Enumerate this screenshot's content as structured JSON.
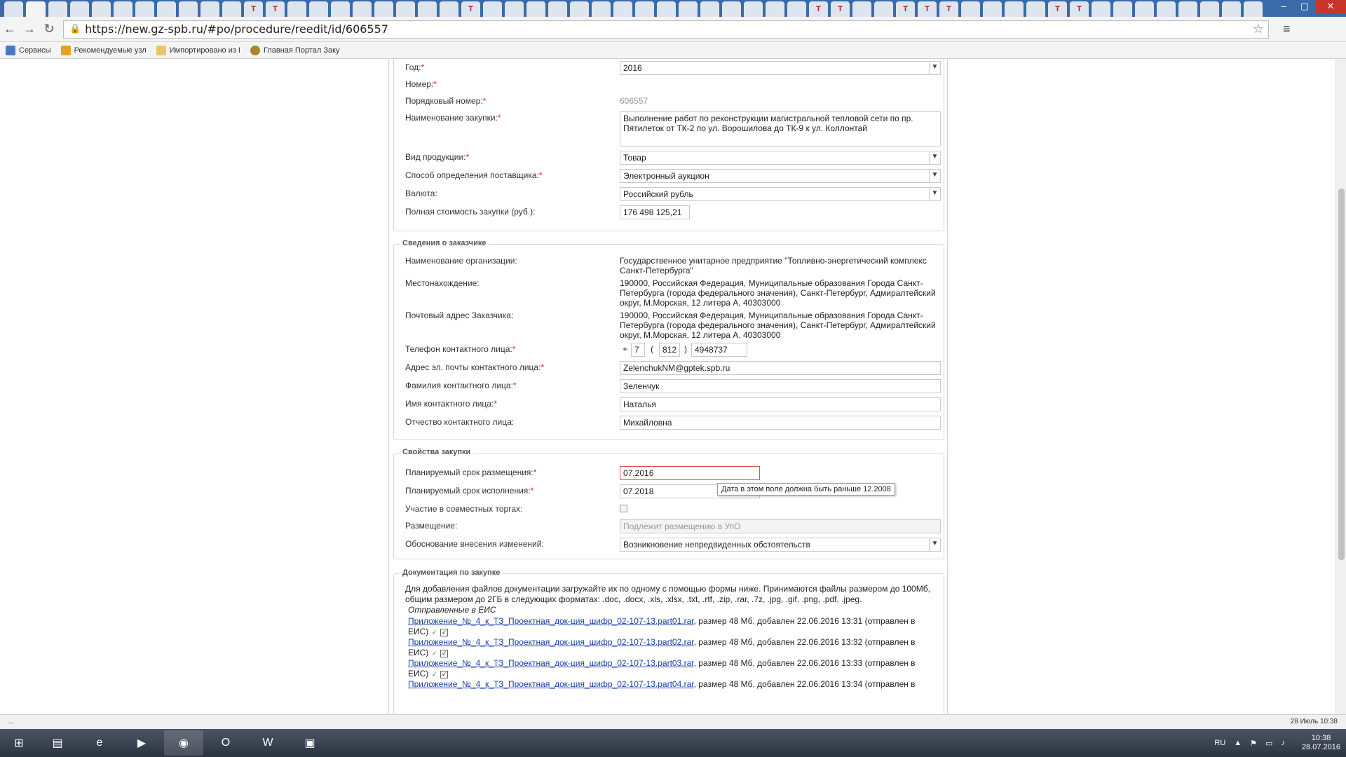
{
  "browser": {
    "url": "https://new.gz-spb.ru/#po/procedure/reedit/id/606557",
    "tab_letters": [
      "",
      "",
      "",
      "",
      "",
      "",
      "",
      "",
      "",
      "",
      "",
      "T",
      "T",
      "",
      "",
      "",
      "",
      "",
      "",
      "",
      "",
      "T",
      "",
      "",
      "",
      "",
      "",
      "",
      "",
      "",
      "",
      "",
      "",
      "",
      "",
      "",
      "",
      "T",
      "T",
      "",
      "",
      "T",
      "T",
      "T",
      "",
      "",
      "",
      "",
      "T",
      "T",
      "",
      "",
      "",
      "",
      "",
      "",
      "",
      ""
    ],
    "bookmarks": [
      "Сервисы",
      "Рекомендуемые узл",
      "Импортировано из I",
      "Главная Портал Заку"
    ]
  },
  "form": {
    "year": {
      "label": "Год:",
      "value": "2016"
    },
    "number": {
      "label": "Номер:"
    },
    "seq_number": {
      "label": "Порядковый номер:",
      "value": "606557"
    },
    "purchase_name": {
      "label": "Наименование закупки:",
      "value": "Выполнение работ по реконструкции магистральной тепловой сети по пр. Пятилеток от ТК-2 по ул. Ворошилова до ТК-9 к ул. Коллонтай"
    },
    "product_type": {
      "label": "Вид продукции:",
      "value": "Товар"
    },
    "supplier_method": {
      "label": "Способ определения поставщика:",
      "value": "Электронный аукцион"
    },
    "currency": {
      "label": "Валюта:",
      "value": "Российский рубль"
    },
    "total_cost": {
      "label": "Полная стоимость закупки (руб.):",
      "value": "176 498 125,21"
    }
  },
  "customer": {
    "legend": "Сведения о заказчике",
    "org": {
      "label": "Наименование организации:",
      "value": "Государственное унитарное предприятие \"Топливно-энергетический комплекс Санкт-Петербурга\""
    },
    "location": {
      "label": "Местонахождение:",
      "value": "190000, Российская Федерация, Муниципальные образования Города Санкт-Петербурга (города федерального значения), Санкт-Петербург, Адмиралтейский округ, М.Морская, 12 литера А, 40303000"
    },
    "postal": {
      "label": "Почтовый адрес Заказчика:",
      "value": "190000, Российская Федерация, Муниципальные образования Города Санкт-Петербурга (города федерального значения), Санкт-Петербург, Адмиралтейский округ, М.Морская, 12 литера А, 40303000"
    },
    "phone": {
      "label": "Телефон контактного лица:",
      "plus": "+",
      "country": "7",
      "open": "(",
      "code": "812",
      "close": ")",
      "number": "4948737"
    },
    "email": {
      "label": "Адрес эл. почты контактного лица:",
      "value": "ZelenchukNM@gptek.spb.ru"
    },
    "last_name": {
      "label": "Фамилия контактного лица:",
      "value": "Зеленчук"
    },
    "first_name": {
      "label": "Имя контактного лица:",
      "value": "Наталья"
    },
    "middle_name": {
      "label": "Отчество контактного лица:",
      "value": "Михайловна"
    }
  },
  "properties": {
    "legend": "Свойства закупки",
    "placement_date": {
      "label": "Планируемый срок размещения:",
      "value": "07.2016"
    },
    "execution_date": {
      "label": "Планируемый срок исполнения:",
      "value": "07.2018"
    },
    "tooltip": "Дата в этом поле должна быть раньше 12.2008",
    "joint": {
      "label": "Участие в совместных торгах:"
    },
    "placement": {
      "label": "Размещение:",
      "placeholder": "Подлежит размещению в УпО"
    },
    "change_reason": {
      "label": "Обоснование внесения изменений:",
      "value": "Возникновение непредвиденных обстоятельств"
    }
  },
  "docs": {
    "legend": "Документация по закупке",
    "intro": "Для добавления файлов документации загружайте их по одному с помощью формы ниже. Принимаются файлы размером до 100Мб, общим размером до 2ГБ в следующих форматах: .doc, .docx, .xls, .xlsx, .txt, .rtf, .zip, .rar, .7z, .jpg, .gif, .png, .pdf, .jpeg.",
    "sent_title": "Отправленные в ЕИС",
    "files": [
      {
        "name": "Приложение_№_4_к_ТЗ_Проектная_док-ция_шифр_02-107-13.part01.rar",
        "info": ", размер 48 Мб, добавлен 22.06.2016 13:31 (отправлен в",
        "tail": "ЕИС)"
      },
      {
        "name": "Приложение_№_4_к_ТЗ_Проектная_док-ция_шифр_02-107-13.part02.rar",
        "info": ", размер 48 Мб, добавлен 22.06.2016 13:32 (отправлен в",
        "tail": "ЕИС)"
      },
      {
        "name": "Приложение_№_4_к_ТЗ_Проектная_док-ция_шифр_02-107-13.part03.rar",
        "info": ", размер 48 Мб, добавлен 22.06.2016 13:33 (отправлен в",
        "tail": "ЕИС)"
      },
      {
        "name": "Приложение_№_4_к_ТЗ_Проектная_док-ция_шифр_02-107-13.part04.rar",
        "info": ", размер 48 Мб, добавлен 22.06.2016 13:34 (отправлен в",
        "tail": ""
      }
    ]
  },
  "status_bar": {
    "left": "...",
    "right": "28 Июль 10:38"
  },
  "taskbar": {
    "lang": "RU",
    "time": "10:38",
    "date": "28.07.2016"
  }
}
